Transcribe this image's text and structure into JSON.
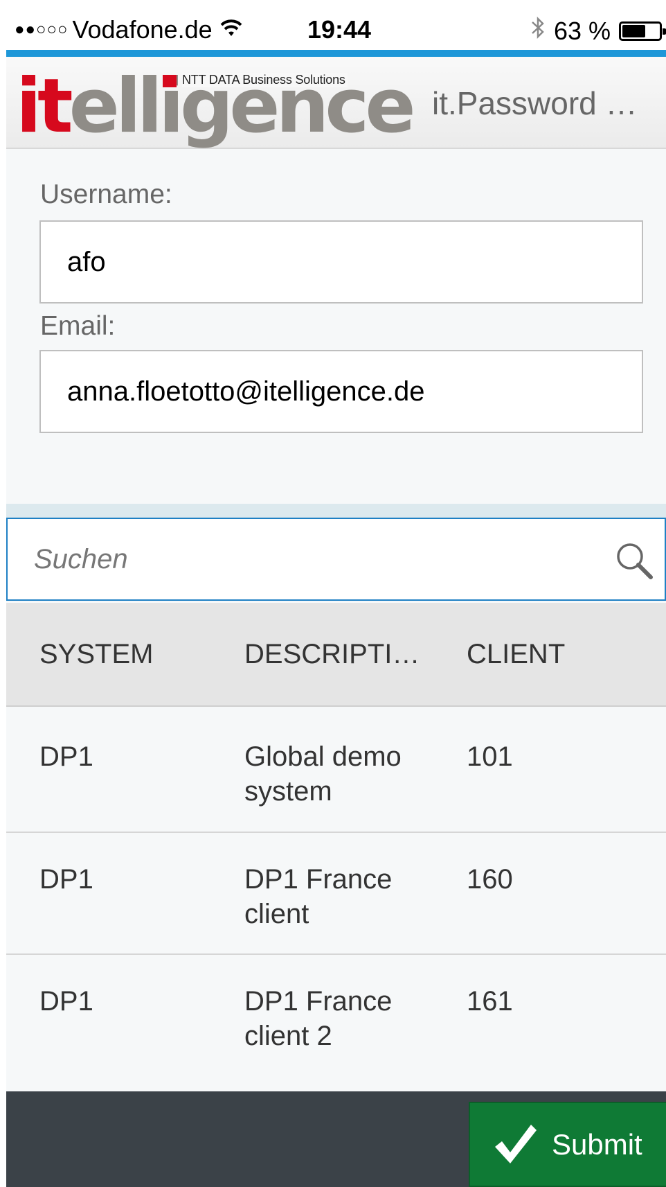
{
  "status_bar": {
    "signal": "●●○○○",
    "carrier": "Vodafone.de",
    "wifi_icon": "wifi-icon",
    "time": "19:44",
    "bluetooth_icon": "bluetooth-icon",
    "battery_text": "63 %",
    "battery_level": 0.63
  },
  "header": {
    "logo_text_red": "it",
    "logo_text_gray": "elligence",
    "logo_tagline": "NTT DATA Business Solutions",
    "title": "it.Password …",
    "accent_color": "#1e97d8",
    "logo_red": "#d6091d"
  },
  "form": {
    "username_label": "Username:",
    "username_value": "afo",
    "email_label": "Email:",
    "email_value": "anna.floetotto@itelligence.de"
  },
  "search": {
    "placeholder": "Suchen",
    "icon": "search-icon"
  },
  "table": {
    "columns": [
      "SYSTEM",
      "DESCRIPTI…",
      "CLIENT"
    ],
    "rows": [
      {
        "system": "DP1",
        "description_line1": "Global demo",
        "description_line2": "system",
        "client": "101"
      },
      {
        "system": "DP1",
        "description_line1": "DP1 France",
        "description_line2": "client",
        "client": "160"
      },
      {
        "system": "DP1",
        "description_line1": "DP1 France",
        "description_line2": "client 2",
        "client": "161"
      }
    ]
  },
  "footer": {
    "submit_label": "Submit",
    "submit_icon": "checkmark-icon",
    "submit_color": "#0f7a35"
  }
}
